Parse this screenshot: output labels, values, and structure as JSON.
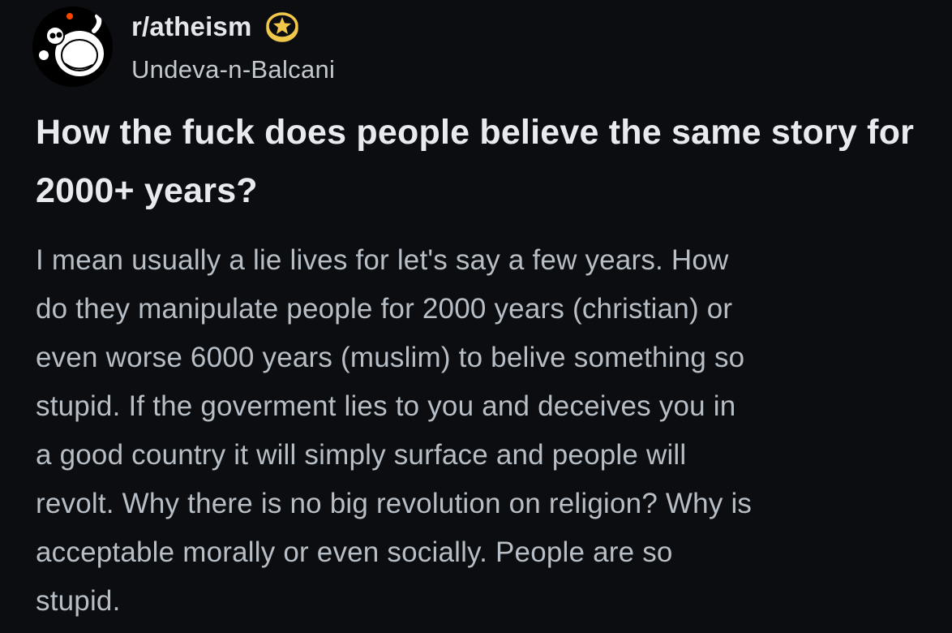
{
  "post": {
    "subreddit": "r/atheism",
    "badge_icon": "gold-coin-star-icon",
    "username": "Undeva-n-Balcani",
    "title": "How the fuck does people believe the same story for 2000+ years?",
    "body_lines": [
      "I mean usually a lie lives for let's say a few years. How",
      "do they manipulate people for 2000 years (christian) or",
      "even worse 6000 years (muslim) to belive something so",
      "stupid. If the goverment lies to you and deceives you in",
      "a good country it will simply surface and people will",
      "revolt. Why there is no big revolution on religion? Why is",
      "acceptable morally or even socially. People are so",
      "stupid."
    ]
  },
  "colors": {
    "background": "#0b0d10",
    "title": "#e8eaed",
    "body_text": "#b8bec6",
    "subreddit": "#e3e6ea",
    "username": "#c4c9cf",
    "badge_gold": "#f2c84b"
  }
}
